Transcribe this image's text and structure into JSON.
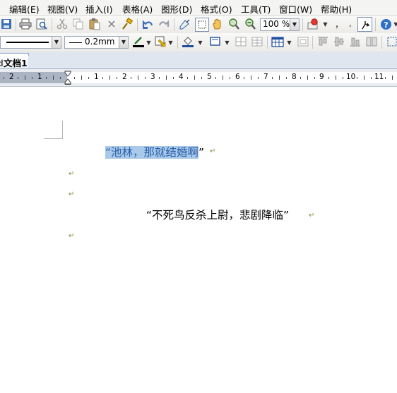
{
  "menu": {
    "items": [
      "编辑(E)",
      "视图(V)",
      "插入(I)",
      "表格(A)",
      "图形(D)",
      "格式(O)",
      "工具(T)",
      "窗口(W)",
      "帮助(H)"
    ]
  },
  "toolbar": {
    "zoom": "100 %",
    "comma": ",",
    "comma_small": "，",
    "line_width": "0.2mm",
    "icons": {
      "save": "save-icon",
      "print": "print-icon",
      "preview": "print-preview-icon",
      "cut": "cut-icon",
      "copy": "copy-icon",
      "paste": "paste-icon",
      "delete": "delete-icon",
      "format_painter": "format-painter-icon",
      "undo": "undo-icon",
      "redo": "redo-icon",
      "draw": "draw-icon",
      "select": "select-icon",
      "hand": "hand-icon",
      "zoom_in": "zoom-in-icon",
      "zoom_out": "zoom-out-icon",
      "insert_object": "insert-object-icon",
      "special": "special-icon",
      "help": "help-icon"
    }
  },
  "tabs": {
    "active": "文档1",
    "prefix": "d"
  },
  "ruler": {
    "numbers": [
      "2",
      "1",
      "1",
      "2",
      "3",
      "4",
      "5",
      "6",
      "7",
      "8",
      "9",
      "10",
      "11"
    ]
  },
  "document": {
    "line1_selected": "“池林，那就结婚啊",
    "line1_rest": "”",
    "line4": "“不死鸟反杀上尉，悲剧降临”",
    "paragraph_mark": "↵"
  },
  "colors": {
    "selection": "#a9c9ea",
    "para_mark": "#8a8a3a",
    "ruler_margin": "#aab4c3"
  }
}
